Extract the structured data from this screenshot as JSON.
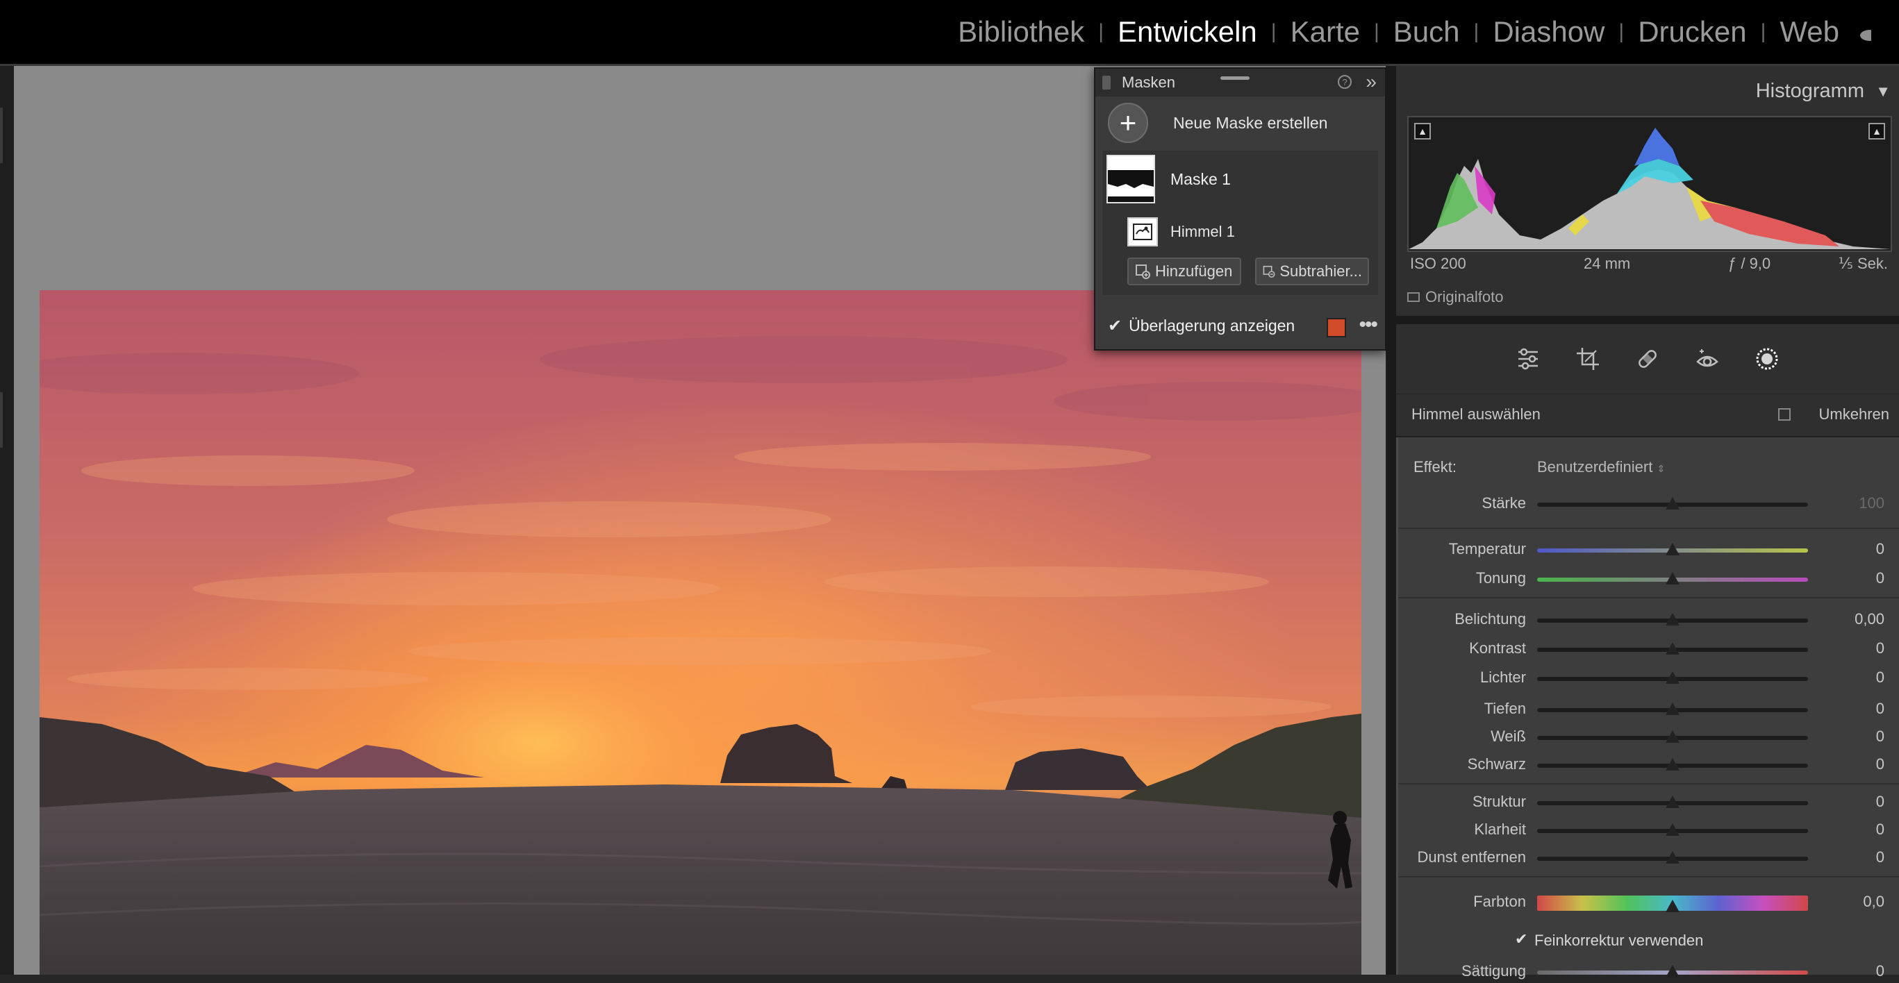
{
  "top_bar": {
    "modules": [
      {
        "label": "Bibliothek",
        "active": false
      },
      {
        "label": "Entwickeln",
        "active": true
      },
      {
        "label": "Karte",
        "active": false
      },
      {
        "label": "Buch",
        "active": false
      },
      {
        "label": "Diashow",
        "active": false
      },
      {
        "label": "Drucken",
        "active": false
      },
      {
        "label": "Web",
        "active": false
      }
    ],
    "separator": "|"
  },
  "masks_panel": {
    "title": "Masken",
    "help_icon": "help-circle-icon",
    "collapse_icon": "double-chevron-right-icon",
    "new_mask_icon": "plus",
    "new_mask_label": "Neue Maske erstellen",
    "masks": [
      {
        "label": "Maske 1",
        "components": [
          {
            "label": "Himmel 1",
            "icon": "sky-icon"
          }
        ]
      }
    ],
    "add_label": "Hinzufügen",
    "subtract_label": "Subtrahier...",
    "overlay_label": "Überlagerung anzeigen",
    "overlay_checked": true,
    "overlay_color": "#d24b2a"
  },
  "histogram": {
    "title": "Histogramm",
    "iso": "ISO 200",
    "focal_length": "24 mm",
    "aperture": "ƒ / 9,0",
    "shutter": "⅕ Sek.",
    "original_photo_label": "Originalfoto"
  },
  "tools": [
    "edit-sliders-icon",
    "crop-icon",
    "healing-icon",
    "red-eye-icon",
    "masking-icon"
  ],
  "adjustments": {
    "header": "Himmel auswählen",
    "invert_label": "Umkehren",
    "effect_label": "Effekt:",
    "effect_value": "Benutzerdefiniert",
    "sliders": {
      "amount": {
        "label": "Stärke",
        "value": "100",
        "position": 0.5
      },
      "temperature": {
        "label": "Temperatur",
        "value": "0",
        "position": 0.5
      },
      "tint": {
        "label": "Tonung",
        "value": "0",
        "position": 0.5
      },
      "exposure": {
        "label": "Belichtung",
        "value": "0,00",
        "position": 0.5
      },
      "contrast": {
        "label": "Kontrast",
        "value": "0",
        "position": 0.5
      },
      "highlights": {
        "label": "Lichter",
        "value": "0",
        "position": 0.5
      },
      "shadows": {
        "label": "Tiefen",
        "value": "0",
        "position": 0.5
      },
      "whites": {
        "label": "Weiß",
        "value": "0",
        "position": 0.5
      },
      "blacks": {
        "label": "Schwarz",
        "value": "0",
        "position": 0.5
      },
      "texture": {
        "label": "Struktur",
        "value": "0",
        "position": 0.5
      },
      "clarity": {
        "label": "Klarheit",
        "value": "0",
        "position": 0.5
      },
      "dehaze": {
        "label": "Dunst entfernen",
        "value": "0",
        "position": 0.5
      },
      "hue": {
        "label": "Farbton",
        "value": "0,0",
        "position": 0.5
      },
      "saturation": {
        "label": "Sättigung",
        "value": "0",
        "position": 0.5
      }
    },
    "fine_adjust_label": "Feinkorrektur verwenden",
    "fine_adjust_checked": true
  }
}
